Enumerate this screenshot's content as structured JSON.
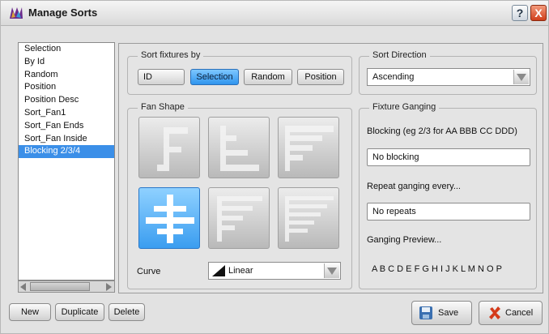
{
  "window": {
    "title": "Manage Sorts",
    "help_label": "?",
    "close_label": "X"
  },
  "sort_list": {
    "items": [
      "Selection",
      "By Id",
      "Random",
      "Position",
      "Position Desc",
      "Sort_Fan1",
      "Sort_Fan Ends",
      "Sort_Fan Inside",
      "Blocking 2/3/4"
    ],
    "selected_index": 8
  },
  "sort_fixtures": {
    "label": "Sort fixtures by",
    "buttons": [
      "ID",
      "Selection",
      "Random",
      "Position"
    ],
    "active": "Selection"
  },
  "sort_direction": {
    "label": "Sort Direction",
    "value": "Ascending"
  },
  "fan_shape": {
    "label": "Fan Shape",
    "selected_tile": 3,
    "curve_label": "Curve",
    "curve_value": "Linear"
  },
  "fixture_ganging": {
    "label": "Fixture Ganging",
    "blocking_label": "Blocking (eg 2/3 for AA BBB CC DDD)",
    "blocking_value": "No blocking",
    "repeat_label": "Repeat ganging every...",
    "repeat_value": "No repeats",
    "preview_label": "Ganging Preview...",
    "preview_value": "A B C D E F G H I J K L M N O P"
  },
  "footer": {
    "new_label": "New",
    "duplicate_label": "Duplicate",
    "delete_label": "Delete",
    "save_label": "Save",
    "cancel_label": "Cancel"
  },
  "colors": {
    "accent": "#3b8fe8",
    "cancel_icon": "#d43a1a",
    "save_icon": "#3a6fb0"
  }
}
